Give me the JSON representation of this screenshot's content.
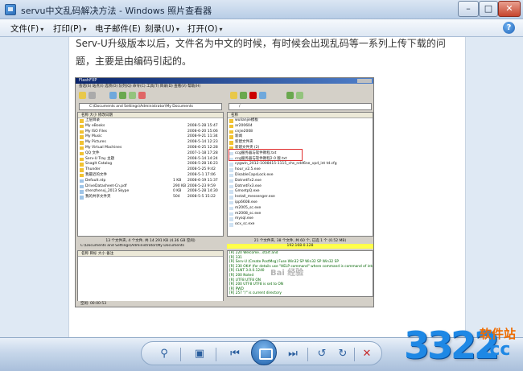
{
  "window": {
    "title": "servu中文乱码解决方法 - Windows 照片查看器",
    "minimize": "–",
    "maximize": "□",
    "close": "✕"
  },
  "menu": [
    {
      "label": "文件(F)"
    },
    {
      "label": "打印(P)"
    },
    {
      "label": "电子邮件(E)"
    },
    {
      "label": "刻录(U)"
    },
    {
      "label": "打开(O)"
    }
  ],
  "document": {
    "line1": "Serv-U升级版本以后，文件名为中文的时候，有时候会出现乱码等一系列上传下载的问",
    "line2": "题，主要是由编码引起的。"
  },
  "screenshot": {
    "title": "FlashFXP",
    "menu": "会话(S)  站点(I)  选项(O)  队列(Q)  命令(C)  工具(T)  目录(D)  查看(V)  帮助(H)",
    "left_path": "C:\\Documents and Settings\\Administrator\\My Documents",
    "right_path": "/",
    "left_header": "名称                                       大小  修改日期",
    "right_header": "名称",
    "left_files": [
      {
        "name": "上层目录",
        "size": "",
        "date": ""
      },
      {
        "name": "My eBooks",
        "size": "",
        "date": "2008-5-28 15:47"
      },
      {
        "name": "My ISO Files",
        "size": "",
        "date": "2008-6-20 15:06"
      },
      {
        "name": "My Music",
        "size": "",
        "date": "2008-9-21 11:34"
      },
      {
        "name": "My Pictures",
        "size": "",
        "date": "2008-5-14 12:23"
      },
      {
        "name": "My Virtual Machines",
        "size": "",
        "date": "2008-6-25 12:28"
      },
      {
        "name": "QQ 文件",
        "size": "",
        "date": "2007-1-18 17:28"
      },
      {
        "name": "Serv-U Tray 主题",
        "size": "",
        "date": "2008-5-14 14:24"
      },
      {
        "name": "SnagIt Catalog",
        "size": "",
        "date": "2008-5-28 16:23"
      },
      {
        "name": "Thunder",
        "size": "",
        "date": "2008-5-25 9:42"
      },
      {
        "name": "我最近的文件",
        "size": "",
        "date": "2008-5-1 17:06"
      },
      {
        "name": "Default.rdp",
        "size": "1 KB",
        "date": "2008-6-19 11:37"
      },
      {
        "name": "DriveDatasheet-Cn.pdf",
        "size": "290 KB",
        "date": "2008-5-23 9:59"
      },
      {
        "name": "shenzhenxj_2013 Skype",
        "size": "0 KB",
        "date": "2008-5-28 14:30"
      },
      {
        "name": "我的共享文件夹",
        "size": "504",
        "date": "2008-5-5 15:22"
      }
    ],
    "right_files": [
      "wulianjie模板",
      "ar200604",
      "cnjie2008",
      "新闻",
      "新建文件夹",
      "新建文件夹 (2)",
      "ccg服务器与软件教程.txt",
      "ccg服务器与软件教程2.0 版.txt",
      "cygwin_2012-1008415-1115_chs_ndd6ne_vpd_int td.cfg",
      "hour_v2.5.exe",
      "DisableCapsLock.exe",
      "DotnetFx2.exe",
      "DotnetFx3.exe",
      "GmsetpQ.exe",
      "Install_messenger.exe",
      "ipp6608.exe",
      "m2005_sc.exe",
      "m2008_sc.exe",
      "mysql.exe",
      "ocx_sc.exe"
    ],
    "left_status": "13 个文件夹, 4 个文件, 共 14 291 KB (4.36 GB 空闲)",
    "left_status_path": "C:\\Documents and Settings\\Administrator\\My Documents",
    "right_status": "21 个文件夹, 38 个文件, 共 60 个, 已选 1 个 (0.52 MB)",
    "right_yellow": "192.168.0.128",
    "queue_header": "名称                   目标                    大小  备注",
    "log": [
      "[R] 220 Welcome...start and",
      "[R] 331",
      "[R] Serv-U (Create PostMsg) Fuse Win32 SP Win32 SP Win32 SP",
      "[R] 230 OK# (for details use \"HELP command\" where command is command of interest)",
      "[R] CLNT 3.0.0.1240",
      "[R] 200 Noted",
      "[R] UTF8 UTF8 ON",
      "[R] 200 UTF8 UTF8 is set to ON",
      "[R] PWD",
      "[R] 257 \"/\" is current directory"
    ],
    "bottom": "空闲: 00:00:53",
    "watermark": "Bai 经验"
  },
  "toolbar": {
    "zoom_label": "⚲",
    "fit_label": "▣",
    "prev_label": "⏮",
    "next_label": "⏭",
    "rotl_label": "↺",
    "rotr_label": "↻",
    "delete_label": "✕"
  },
  "watermark_logo": {
    "number": "3322",
    "zh": "软件站",
    "cc": ".cc"
  }
}
